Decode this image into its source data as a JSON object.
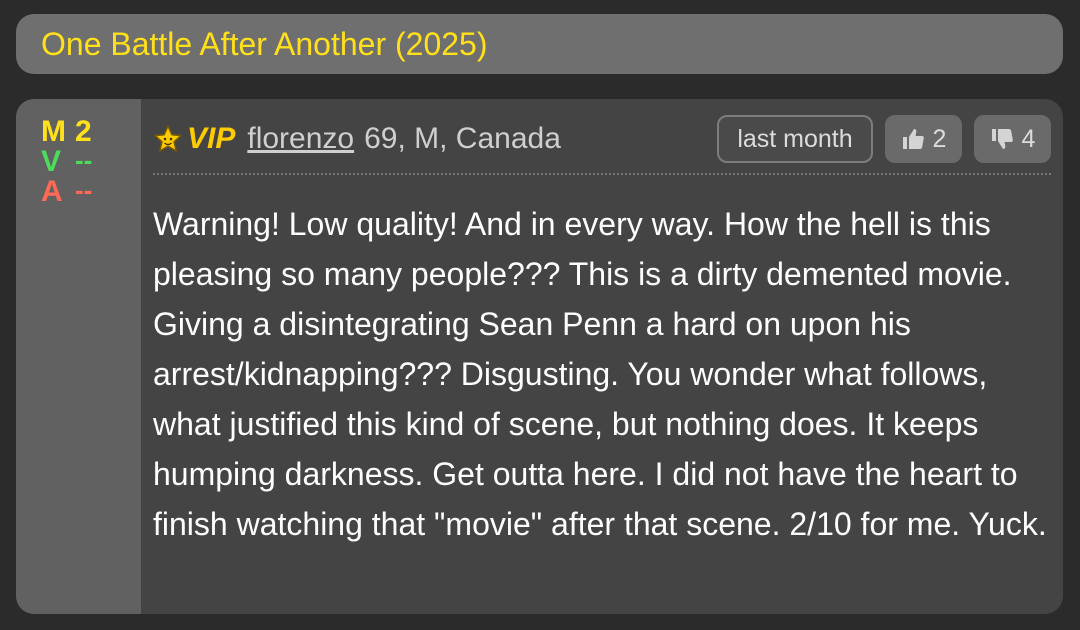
{
  "movie": {
    "title": "One Battle After Another (2025)"
  },
  "review": {
    "scores": {
      "m_label": "M",
      "m_value": "2",
      "v_label": "V",
      "v_value": "--",
      "a_label": "A",
      "a_value": "--"
    },
    "user": {
      "badge": "VIP",
      "name": "florenzo",
      "meta": "69, M, Canada"
    },
    "date": "last month",
    "thumbs_up": "2",
    "thumbs_down": "4",
    "text": "Warning! Low quality! And in every way. How the hell is this pleasing so many people??? This is a dirty demented movie. Giving a disintegrating Sean Penn a hard on upon his arrest/kidnapping??? Disgusting. You wonder what follows, what justified this kind of scene, but nothing does. It keeps humping darkness. Get outta here. I did not have the heart to finish watching that \"movie\" after that scene. 2/10 for me. Yuck."
  },
  "colors": {
    "background": "#2b2b2b",
    "title_bar": "#6f6f6f",
    "title_text": "#ffe01a",
    "card": "#444444",
    "score_col": "#616161",
    "m_score": "#ffe01a",
    "v_score": "#4ddc5a",
    "a_score": "#ff6a55",
    "vip": "#ffcc00"
  },
  "icons": {
    "vip": "star-icon",
    "up": "thumbs-up-icon",
    "down": "thumbs-down-icon"
  }
}
